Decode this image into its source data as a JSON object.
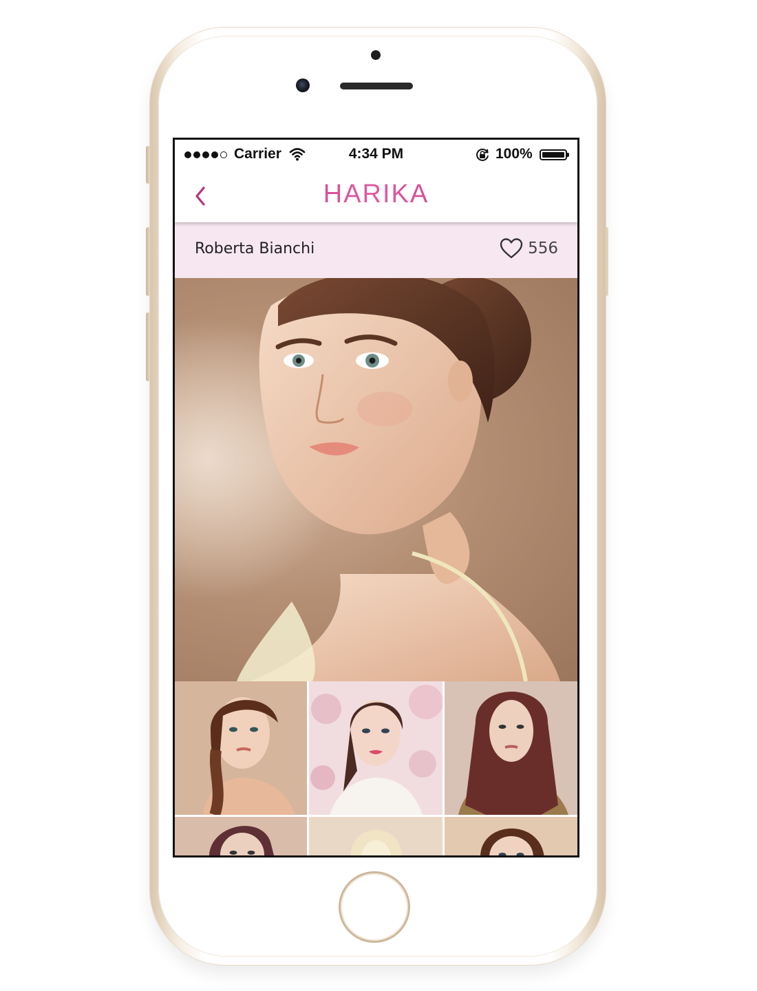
{
  "status_bar": {
    "carrier": "Carrier",
    "time": "4:34 PM",
    "battery": "100%"
  },
  "nav": {
    "brand": "HARIKA",
    "back_icon": "chevron-left-icon"
  },
  "profile": {
    "name": "Roberta Bianchi",
    "likes": "556",
    "like_icon": "heart-icon"
  },
  "colors": {
    "brand": "#c3317f",
    "profile_row_bg": "#f7e7f0",
    "phone_trim": "#d9c7ad"
  },
  "gallery": {
    "thumbnails": [
      {
        "name": "braided-hairstyle-photo"
      },
      {
        "name": "floral-background-photo"
      },
      {
        "name": "long-straight-hair-photo"
      },
      {
        "name": "auburn-hair-photo"
      },
      {
        "name": "blonde-hair-photo"
      },
      {
        "name": "brunette-curls-photo"
      }
    ]
  }
}
